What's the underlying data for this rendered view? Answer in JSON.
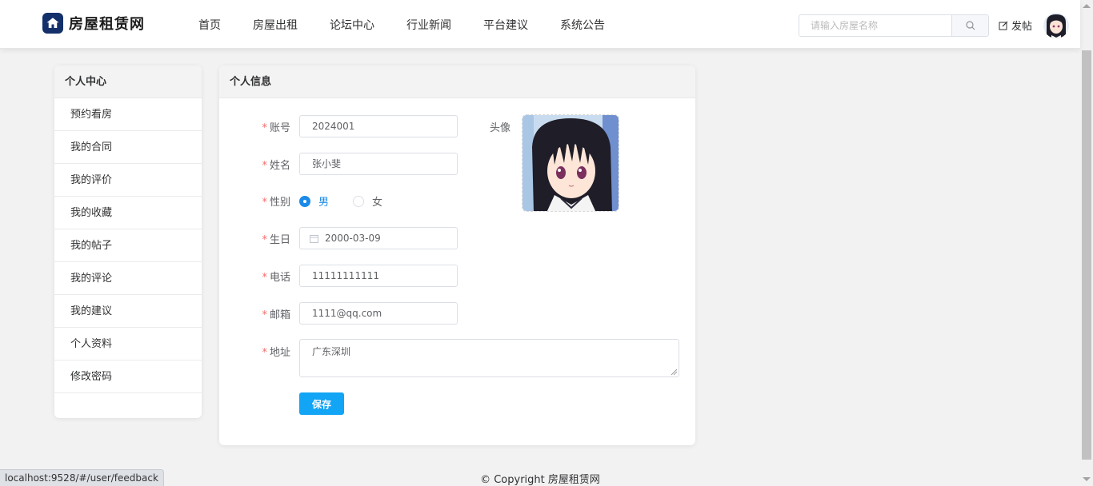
{
  "header": {
    "logo_text": "房屋租赁网",
    "nav": [
      "首页",
      "房屋出租",
      "论坛中心",
      "行业新闻",
      "平台建议",
      "系统公告"
    ],
    "search_placeholder": "请输入房屋名称",
    "post_label": "发帖"
  },
  "sidebar": {
    "title": "个人中心",
    "items": [
      "预约看房",
      "我的合同",
      "我的评价",
      "我的收藏",
      "我的帖子",
      "我的评论",
      "我的建议",
      "个人资料",
      "修改密码"
    ]
  },
  "profile": {
    "title": "个人信息",
    "required_mark": "*",
    "fields": {
      "account": {
        "label": "账号",
        "value": "2024001"
      },
      "name": {
        "label": "姓名",
        "value": "张小斐"
      },
      "gender": {
        "label": "性别",
        "options": [
          "男",
          "女"
        ],
        "selected": "男"
      },
      "birthday": {
        "label": "生日",
        "value": "2000-03-09"
      },
      "phone": {
        "label": "电话",
        "value": "11111111111"
      },
      "email": {
        "label": "邮箱",
        "value": "1111@qq.com"
      },
      "address": {
        "label": "地址",
        "value": "广东深圳"
      }
    },
    "avatar_label": "头像",
    "save_label": "保存"
  },
  "footer": {
    "copyright": "© Copyright 房屋租赁网"
  },
  "status_bar": {
    "url": "localhost:9528/#/user/feedback"
  },
  "colors": {
    "primary": "#12a4f5",
    "radio_selected": "#1b8ae8",
    "required": "#f56c6c",
    "logo_bg": "#14306b"
  },
  "icons": {
    "logo": "house-icon",
    "search": "search-icon",
    "post": "edit-icon",
    "date": "calendar-icon"
  }
}
